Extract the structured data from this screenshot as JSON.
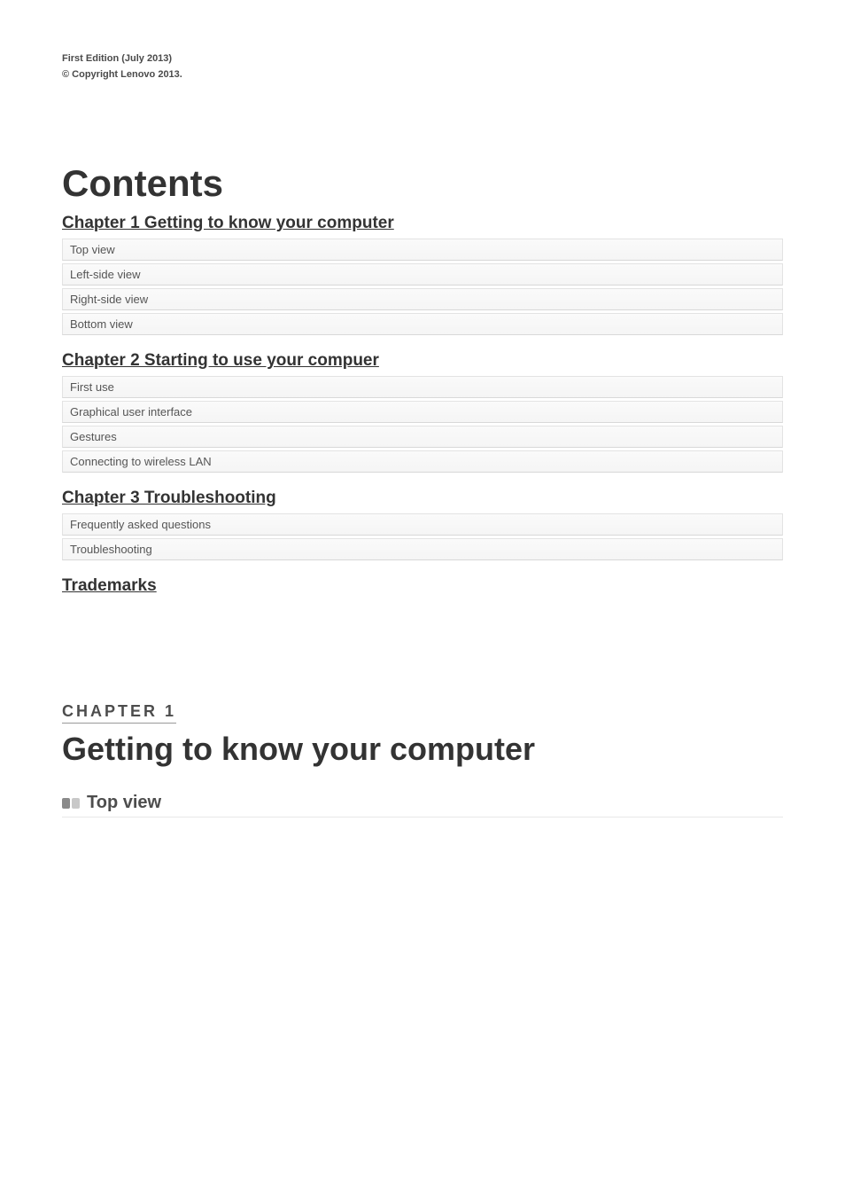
{
  "meta": {
    "edition": "First Edition (July 2013)",
    "copyright": "© Copyright Lenovo 2013."
  },
  "contents": {
    "title": "Contents",
    "chapters": [
      {
        "heading": "Chapter 1 Getting to know your computer",
        "items": [
          "Top view",
          "Left-side view",
          "Right-side view",
          "Bottom view"
        ]
      },
      {
        "heading": "Chapter 2 Starting to use your compuer",
        "items": [
          "First use",
          "Graphical user interface",
          "Gestures",
          "Connecting to wireless LAN"
        ]
      },
      {
        "heading": "Chapter 3 Troubleshooting",
        "items": [
          "Frequently asked questions",
          "Troubleshooting"
        ]
      },
      {
        "heading": "Trademarks",
        "items": []
      }
    ]
  },
  "chapter1": {
    "label": "CHAPTER 1",
    "title": "Getting to know your computer",
    "section1": "Top view"
  }
}
